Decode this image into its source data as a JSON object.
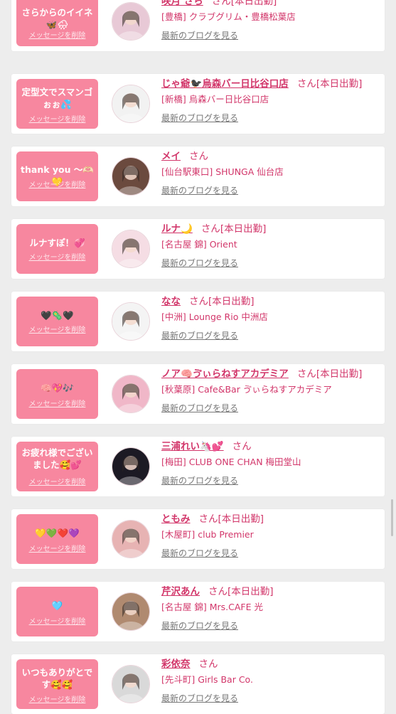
{
  "messages": [
    {
      "message": "さらからのイイネ🦋🌧",
      "delete_label": "メッセージを削除",
      "name": "咲月 さら",
      "honorific": "さん",
      "work_status": "[本日出勤]",
      "shop": "[豊橋] クラブグリム・豊橋松葉店",
      "blog_link": "最新のブログを見る",
      "avatar_color": "#e8c9d6"
    },
    {
      "message": "定型文でスマンゴぉぉ💦",
      "delete_label": "メッセージを削除",
      "name": "じゃ爺🐦‍⬛烏森バー日比谷口店",
      "honorific": "さん",
      "work_status": "[本日出勤]",
      "shop": "[新橋] 烏森バー日比谷口店",
      "blog_link": "最新のブログを見る",
      "avatar_color": "#f2f2f2"
    },
    {
      "message": "thank you 〜🫶🏻💛",
      "delete_label": "メッセージを削除",
      "name": "メイ",
      "honorific": "さん",
      "work_status": "",
      "shop": "[仙台駅東口] SHUNGA 仙台店",
      "blog_link": "最新のブログを見る",
      "avatar_color": "#6b4a3e"
    },
    {
      "message": "ルナすぽ！💞",
      "delete_label": "メッセージを削除",
      "name": "ルナ🌙",
      "honorific": "さん",
      "work_status": "[本日出勤]",
      "shop": "[名古屋 錦] Orient",
      "blog_link": "最新のブログを見る",
      "avatar_color": "#f5dde4"
    },
    {
      "message": "🖤🦠🖤",
      "delete_label": "メッセージを削除",
      "name": "なな",
      "honorific": "さん",
      "work_status": "[本日出勤]",
      "shop": "[中洲] Lounge Rio 中洲店",
      "blog_link": "最新のブログを見る",
      "avatar_color": "#f4f4f4"
    },
    {
      "message": "🧠💖🎶",
      "delete_label": "メッセージを削除",
      "name": "ノア🧠ゔぃらねすアカデミア",
      "honorific": "さん",
      "work_status": "[本日出勤]",
      "shop": "[秋葉原] Cafe&Bar ゔぃらねすアカデミア",
      "blog_link": "最新のブログを見る",
      "avatar_color": "#f0b7c8"
    },
    {
      "message": "お疲れ様でございました🥰💕",
      "delete_label": "メッセージを削除",
      "name": "三浦れい🦄💕",
      "honorific": "さん",
      "work_status": "",
      "shop": "[梅田] CLUB ONE CHAN 梅田堂山",
      "blog_link": "最新のブログを見る",
      "avatar_color": "#1c1a24"
    },
    {
      "message": "💛💚❤️💜",
      "delete_label": "メッセージを削除",
      "name": "ともみ",
      "honorific": "さん",
      "work_status": "[本日出勤]",
      "shop": "[木屋町] club Premier",
      "blog_link": "最新のブログを見る",
      "avatar_color": "#e7b3b3"
    },
    {
      "message": "🩵",
      "delete_label": "メッセージを削除",
      "name": "芹沢あん",
      "honorific": "さん",
      "work_status": "[本日出勤]",
      "shop": "[名古屋 錦] Mrs.CAFE 光",
      "blog_link": "最新のブログを見る",
      "avatar_color": "#b08a70"
    },
    {
      "message": "いつもありがとです🥰🥰",
      "delete_label": "メッセージを削除",
      "name": "彩依奈",
      "honorific": "さん",
      "work_status": "",
      "shop": "[先斗町] Girls Bar Co.",
      "blog_link": "最新のブログを見る",
      "avatar_color": "#d9d9d9"
    }
  ],
  "colors": {
    "bubble": "#f7879f",
    "name": "#d2366a",
    "link_gray": "#777777",
    "background": "#ededed"
  }
}
